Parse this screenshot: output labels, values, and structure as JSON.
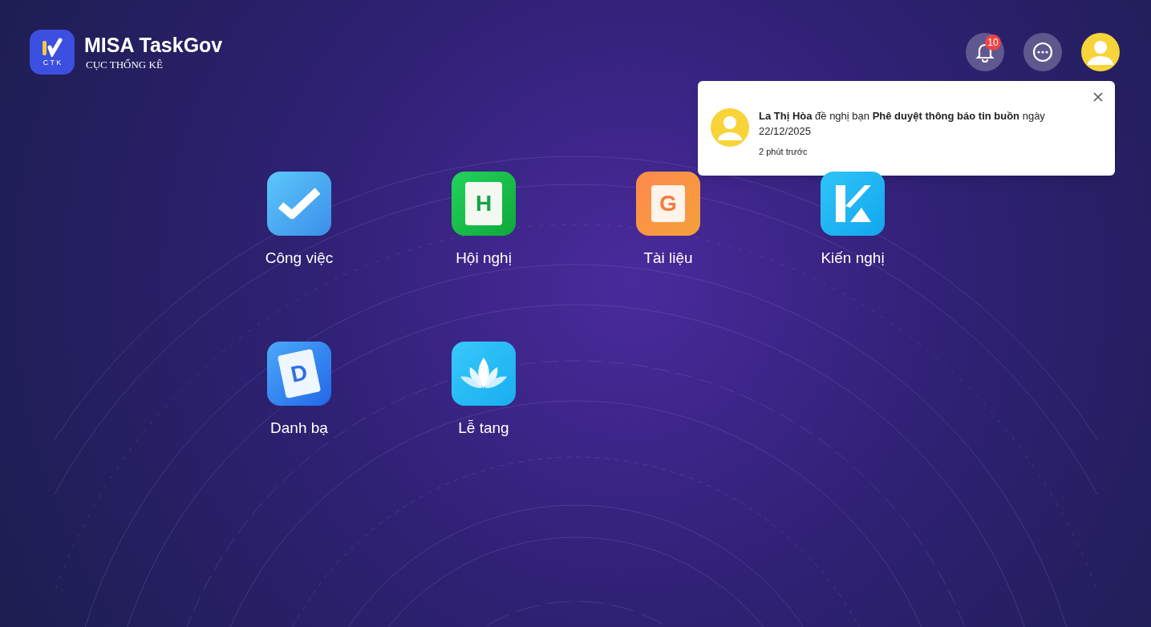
{
  "logo": {
    "badge": "C T K",
    "title": "MISA TaskGov",
    "subtitle": "CỤC THỐNG KÊ"
  },
  "header": {
    "notification_count": "10"
  },
  "notification": {
    "text": "**La Thị Hòa** đề nghị bạn **Phê duyệt thông báo tin buồn** ngày 22/12/2025",
    "time": "2 phút trước"
  },
  "apps": [
    {
      "kind": "check",
      "label": "Công việc"
    },
    {
      "kind": "calendar",
      "glyph": "H",
      "label": "Hội nghị"
    },
    {
      "kind": "doc",
      "glyph": "G",
      "label": "Tài liệu"
    },
    {
      "kind": "k",
      "label": "Kiến nghị"
    },
    {
      "kind": "book",
      "glyph": "D",
      "label": "Danh bạ"
    },
    {
      "kind": "lotus",
      "label": "Lễ tang"
    }
  ]
}
